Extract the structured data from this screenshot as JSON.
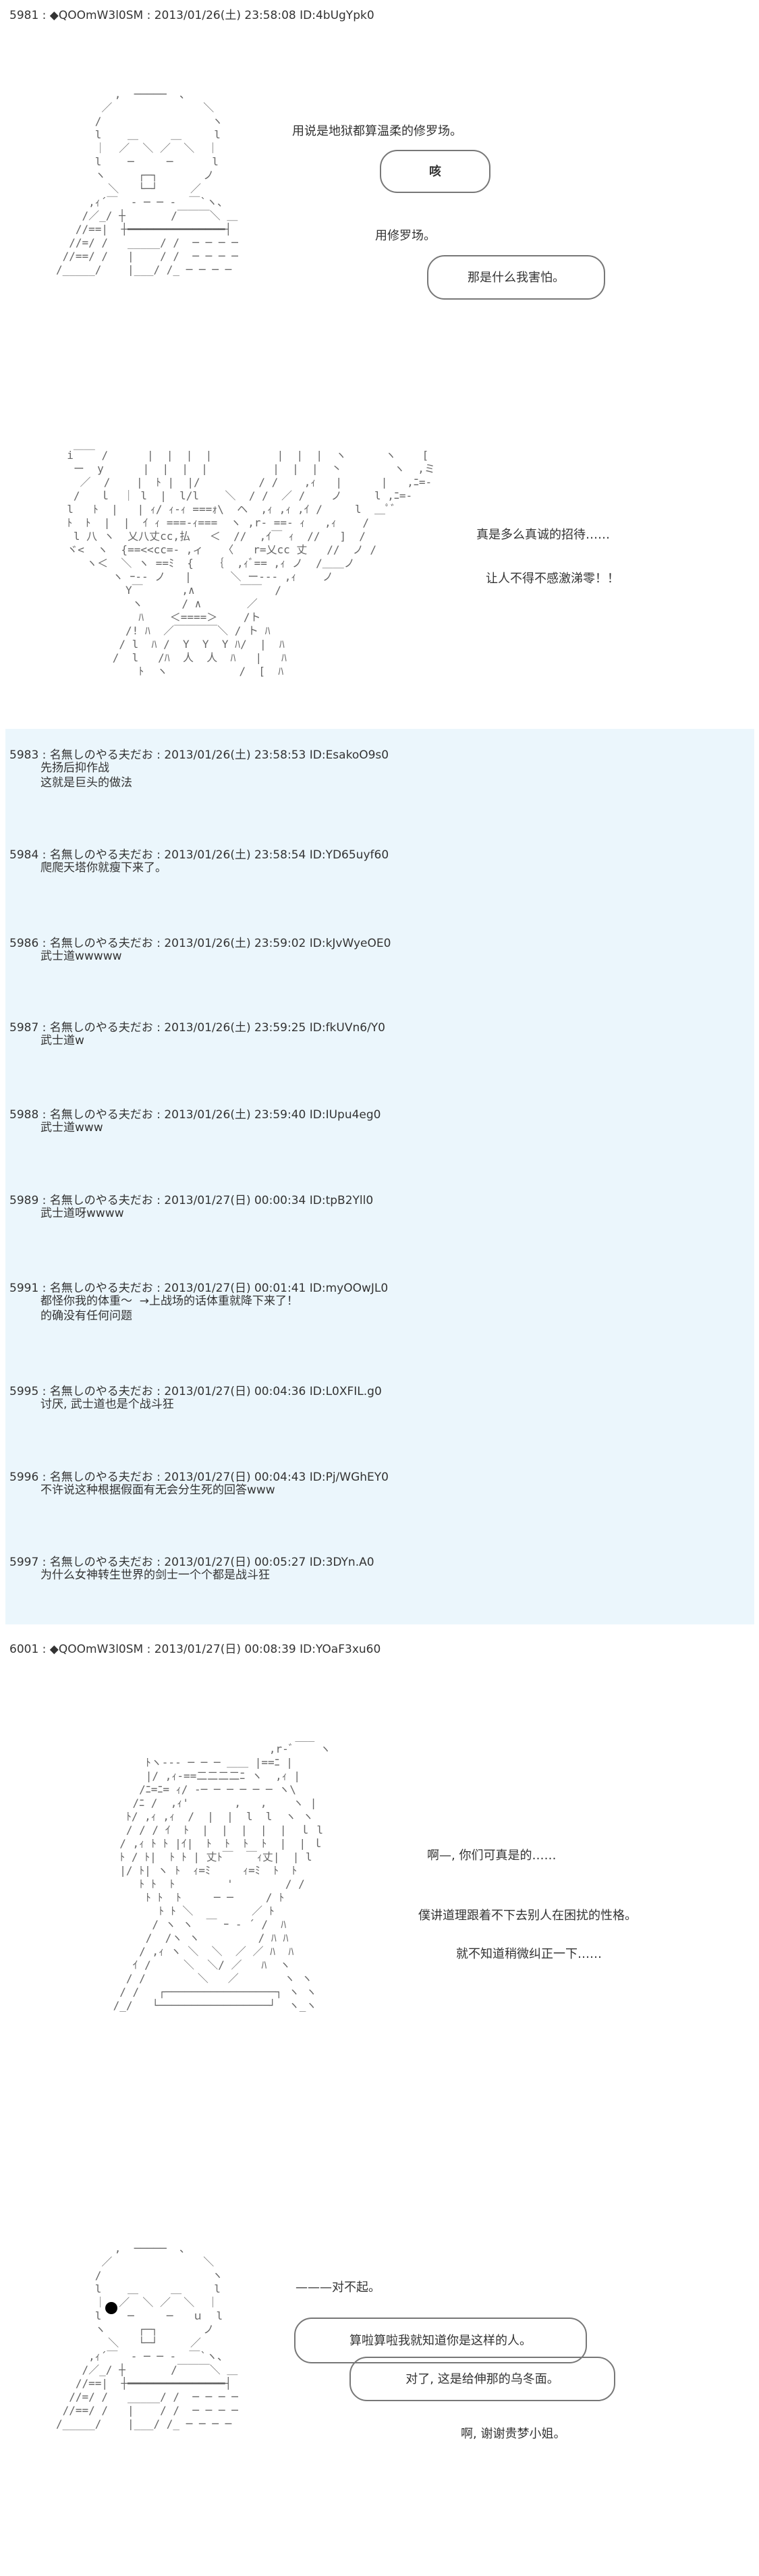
{
  "posts": [
    {
      "header": "5981 : ◆QOOmW3l0SM : 2013/01/26(土) 23:58:08 ID:4bUgYpk0"
    },
    {
      "header": "5983 : 名無しのやる夫だお : 2013/01/26(土) 23:58:53 ID:EsakoO9s0",
      "lines": "先扬后抑作战\n这就是巨头的做法"
    },
    {
      "header": "5984 : 名無しのやる夫だお : 2013/01/26(土) 23:58:54 ID:YD65uyf60",
      "lines": "爬爬天塔你就瘦下来了。"
    },
    {
      "header": "5986 : 名無しのやる夫だお : 2013/01/26(土) 23:59:02 ID:kJvWyeOE0",
      "lines": "武士道wwwww"
    },
    {
      "header": "5987 : 名無しのやる夫だお : 2013/01/26(土) 23:59:25 ID:fkUVn6/Y0",
      "lines": "武士道w"
    },
    {
      "header": "5988 : 名無しのやる夫だお : 2013/01/26(土) 23:59:40 ID:IUpu4eg0",
      "lines": "武士道www"
    },
    {
      "header": "5989 : 名無しのやる夫だお : 2013/01/27(日) 00:00:34 ID:tpB2Yll0",
      "lines": "武士道呀wwww"
    },
    {
      "header": "5991 : 名無しのやる夫だお : 2013/01/27(日) 00:01:41 ID:myOOwJL0",
      "lines": "都怪你我的体重～  →上战场的话体重就降下来了！\n的确没有任何问题"
    },
    {
      "header": "5995 : 名無しのやる夫だお : 2013/01/27(日) 00:04:36 ID:L0XFIL.g0",
      "lines": "讨厌, 武士道也是个战斗狂"
    },
    {
      "header": "5996 : 名無しのやる夫だお : 2013/01/27(日) 00:04:43 ID:Pj/WGhEY0",
      "lines": "不许说这种根据假面有无会分生死的回答www"
    },
    {
      "header": "5997 : 名無しのやる夫だお : 2013/01/27(日) 00:05:27 ID:3DYn.A0",
      "lines": "为什么女神转生世界的剑士一个个都是战斗狂"
    },
    {
      "header": "6001 : ◆QOOmW3l0SM : 2013/01/27(日) 00:08:39 ID:YOaF3xu60"
    }
  ],
  "dialogue": {
    "s1_line1": "用说是地狱都算温柔的修罗场。",
    "s1_bubble1": "咳",
    "s1_line2": "用修罗场。",
    "s1_bubble2": "那是什么我害怕。",
    "s2_line1": "真是多么真诚的招待……",
    "s2_line2": "让人不得不感激涕零！！",
    "s3_line1": "啊—, 你们可真是的……",
    "s3_line2": "僕讲道理跟着不下去别人在困扰的性格。",
    "s3_line3": "就不知道稍微纠正一下……",
    "s4_line1": "———对不起。",
    "s4_bubble1": "算啦算啦我就知道你是这样的人。",
    "s4_bubble2": "对了, 这是给伸那的乌冬面。",
    "s4_line2": "啊, 谢谢贵梦小姐。"
  },
  "ascii": {
    "face1": "         ,  ─────  、\n       ／              ＼\n      /                 ヽ\n      l    ＿     ＿     l\n      ｜  ／  ＼ ／  ＼  ｜\n      l    ─     ─      l\n      ヽ     ┌─┐       ノ\n        ＼   └─┘     ／\n     ,ｨ´￣  ‐ ─ ─ ‐  ￣`ヽ、\n    /／_/ ┼       /￣￣￣＼ ＿\n   //==|  ┼━━━━━━━━━━━━━━━┤\n  //=/ /   _____/ /  ─ ─ ─ ─\n //==/ /   |    / /  ─ ─ ─ ─\n/_____/    |___/ /_ ─ ─ ─ ─",
    "swords": "  i￣￣ /      |  |  |  |          |  |  |  ヽ      ヽ    [\n   ー  y      |  |  |  |          |  |  |  丶        ヽ  ,ミ\n    ／  /    |  ﾄ |  |/         / /    ,ｨ   |      |   ,ﾆ=-\n   /   ｌ  ｜ l  |  l/l    ＼  / /  ／ /    ノ     l ,ﾆ=-\n  l   ﾄ  |   | ｨ/ ｨ-ｨ ===ｫ\\  ヘ  ,ｨ ,ｨ ,ｲ /     l  ＿ﾟﾞ\n  ﾄ  ﾄ  |  |  ｲ ｨ ===-ｨ===  ヽ ,r- ==- ｨ   ,ｨ    /\n   l 八 ヽ  乂八丈cc,払   ＜  //  ,ｲ￣ ｨ  //   ]  /\n  ヾ<  ヽ  {==<<cc=‐ ,ィ   〈   r=乂cc 丈   //  ノ /\n     ヽ＜  ＼ ヽ ==ﾐ  {   ｛  ,ｨﾞ== ,ｨ ノ  /＿＿ノ\n         ヽ ｰ-- ノ   |      ＼ ー--‐ ,ｨ    ノ\n           Y￣      ,∧       ￣￣  /\n            ヽ      / ∧       ／\n             ﾊ    ＜====＞    /ト\n           /! ﾊ  ／￣￣￣￣＼ / ト ﾊ\n          / l  ﾊ /  Y  Y  Y ﾊ/  |  ﾊ\n         /  l   /ﾊ  人  人  ﾊ   |   ﾊ\n             ﾄ  ヽ           /  [  ﾊ",
    "girl": "                             ___\n                         ,r‐ﾞ    ヽ\n      ﾄヽ-‐‐ ─ ─ ─ ＿＿ |==ﾆ |\n      |/ ,ｨ-==二二二二ﾆ ヽ  ,ｨ |\n     /ﾆ=ﾆ= ｨ/ -─ ─ ─ ─ ─ ─ ヽ\\\n    /ﾆ /  ,ｨ'       ,   ,    ヽ |\n   ﾄ/ ,ｨ ,ｨ  /  |  |  l  l  ヽ ヽ\n   / / / ｲ  ﾄ  |  |  |  |  |  ｌ l\n  / ,ｨ ﾄ ﾄ |ｲ|  ﾄ  ﾄ  ﾄ  ﾄ  |  | ｌ\n  ﾄ / ﾄ|  ﾄ ﾄ | 丈ﾄ￣  ￣ｨ丈|  | l\n  |/ ﾄ| ヽ ﾄ  ｨ=ﾐ     ｨ=ﾐ  ﾄ  ﾄ\n     ﾄ ﾄ  ﾄ        '        / /\n      ﾄ ﾄ  ﾄ     ─ ─     / ﾄ\n        ﾄ ﾄ ＼         ／ ﾄ\n       / ヽ ヽ  ￣ ｰ ‐ ´ /  ﾊ\n      /  /ヽ ヽ         / ﾊ ﾊ\n     / ,ｨ ヽ ＼  ＼  ／ ／ ﾊ  ﾊ\n    ｲ /     ＼  ＼/ ／   ﾊ  ヽ\n   / /        ＼   ／       ヽ ヽ\n  / /   ┌─────────────────┐ ヽ ヽ\n /_/   └─────────────────┘  ヽ_ヽ",
    "face2": "         ,  ─────  、\n       ／              ＼\n      /                 ヽ\n      l    ＿     ＿     l\n      ｜  ／  ＼ ／  ＼  ｜\n      l    ─     ─   ｕ  l\n      ヽ     ┌─┐       ノ\n        ＼   └─┘     ／\n     ,ｨ´￣  ‐ ─ ─ ‐  ￣`ヽ、\n    /／_/ ┼       /￣￣￣＼ ＿\n   //==|  ┼━━━━━━━━━━━━━━━┤\n  //=/ /   _____/ /  ─ ─ ─ ─\n //==/ /   |    / /  ─ ─ ─ ─\n/_____/    |___/ /_ ─ ─ ─ ─"
  }
}
